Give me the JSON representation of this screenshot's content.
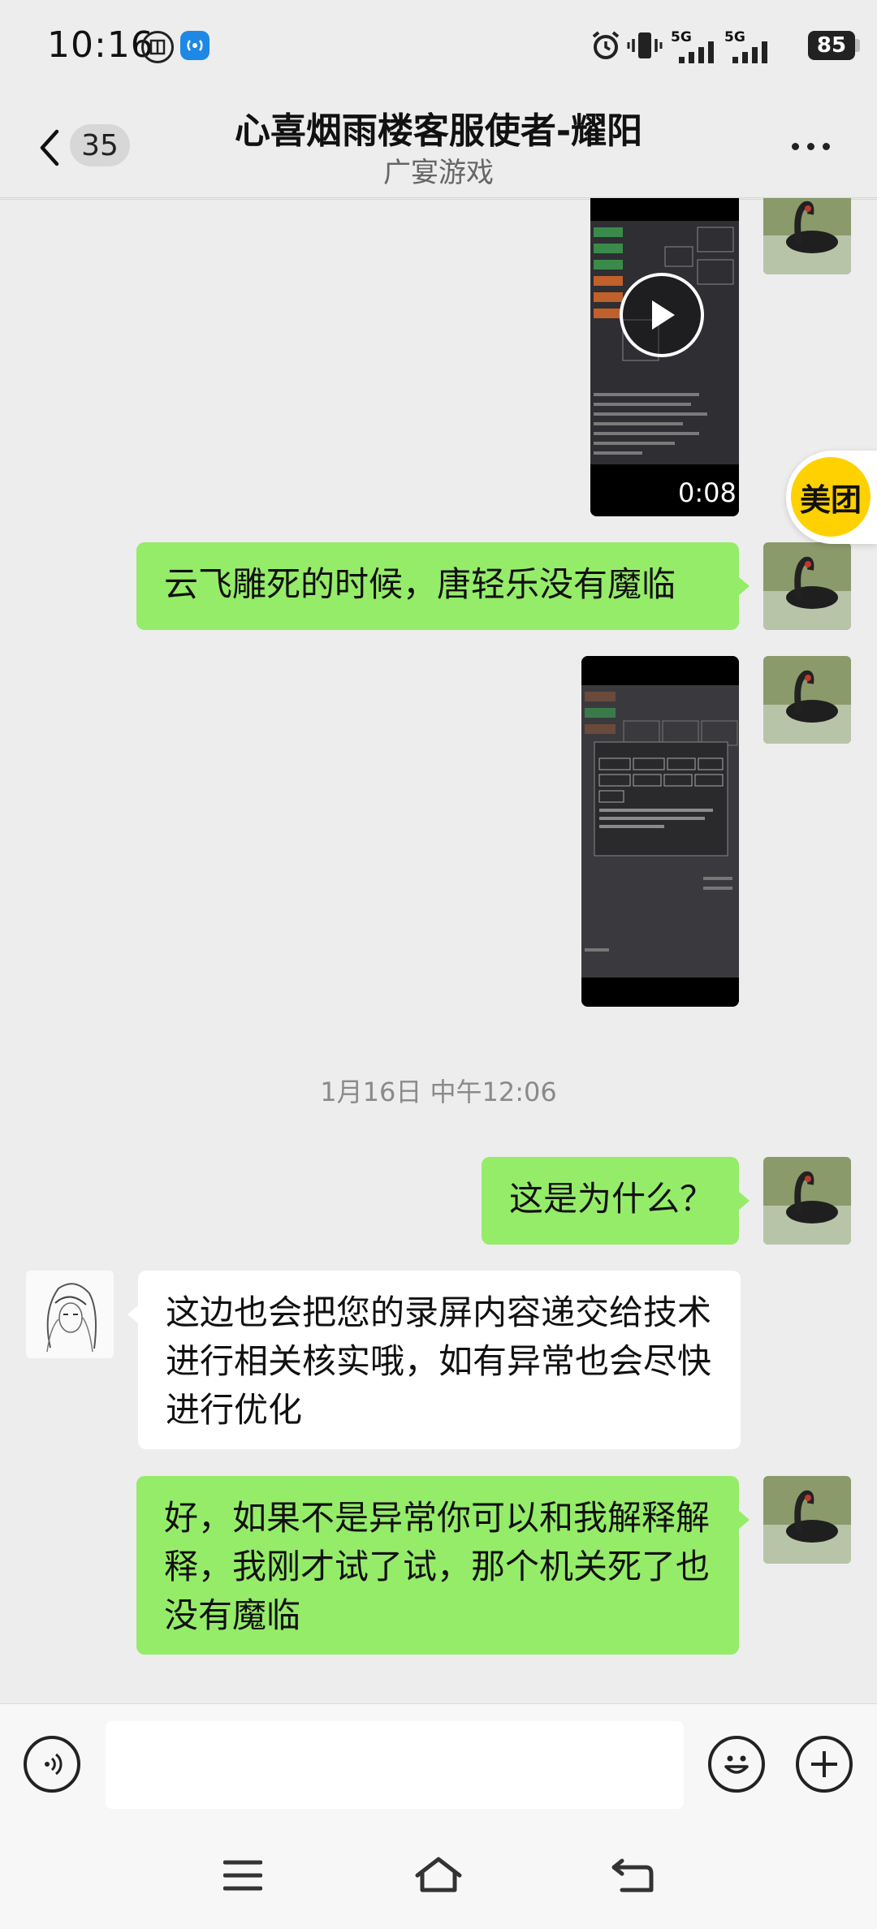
{
  "status_bar": {
    "time": "10:16",
    "net1": "5G",
    "net2": "5G",
    "battery": "85",
    "icons": [
      "china-unicom-icon",
      "hotspot-icon",
      "alarm-icon",
      "vibrate-icon",
      "signal-icon",
      "signal-icon"
    ]
  },
  "header": {
    "unread_count": "35",
    "title": "心喜烟雨楼客服使者-耀阳",
    "subtitle": "广宴游戏"
  },
  "messages": [
    {
      "side": "right",
      "type": "video",
      "duration": "0:08"
    },
    {
      "side": "right",
      "type": "text",
      "text": "云飞雕死的时候，唐轻乐没有魔临"
    },
    {
      "side": "right",
      "type": "image"
    },
    {
      "type": "timestamp",
      "text": "1月16日 中午12:06"
    },
    {
      "side": "right",
      "type": "text",
      "text": "这是为什么？"
    },
    {
      "side": "left",
      "type": "text",
      "text": "这边也会把您的录屏内容递交给技术进行相关核实哦，如有异常也会尽快进行优化"
    },
    {
      "side": "right",
      "type": "text",
      "text": "好，如果不是异常你可以和我解释解释，我刚才试了试，那个机关死了也没有魔临"
    }
  ],
  "floating": {
    "meituan_label": "美团"
  },
  "input": {
    "value": "",
    "placeholder": ""
  },
  "colors": {
    "bubble_me": "#95ec69",
    "bubble_other": "#ffffff",
    "background": "#ededed",
    "meituan": "#ffd100"
  }
}
